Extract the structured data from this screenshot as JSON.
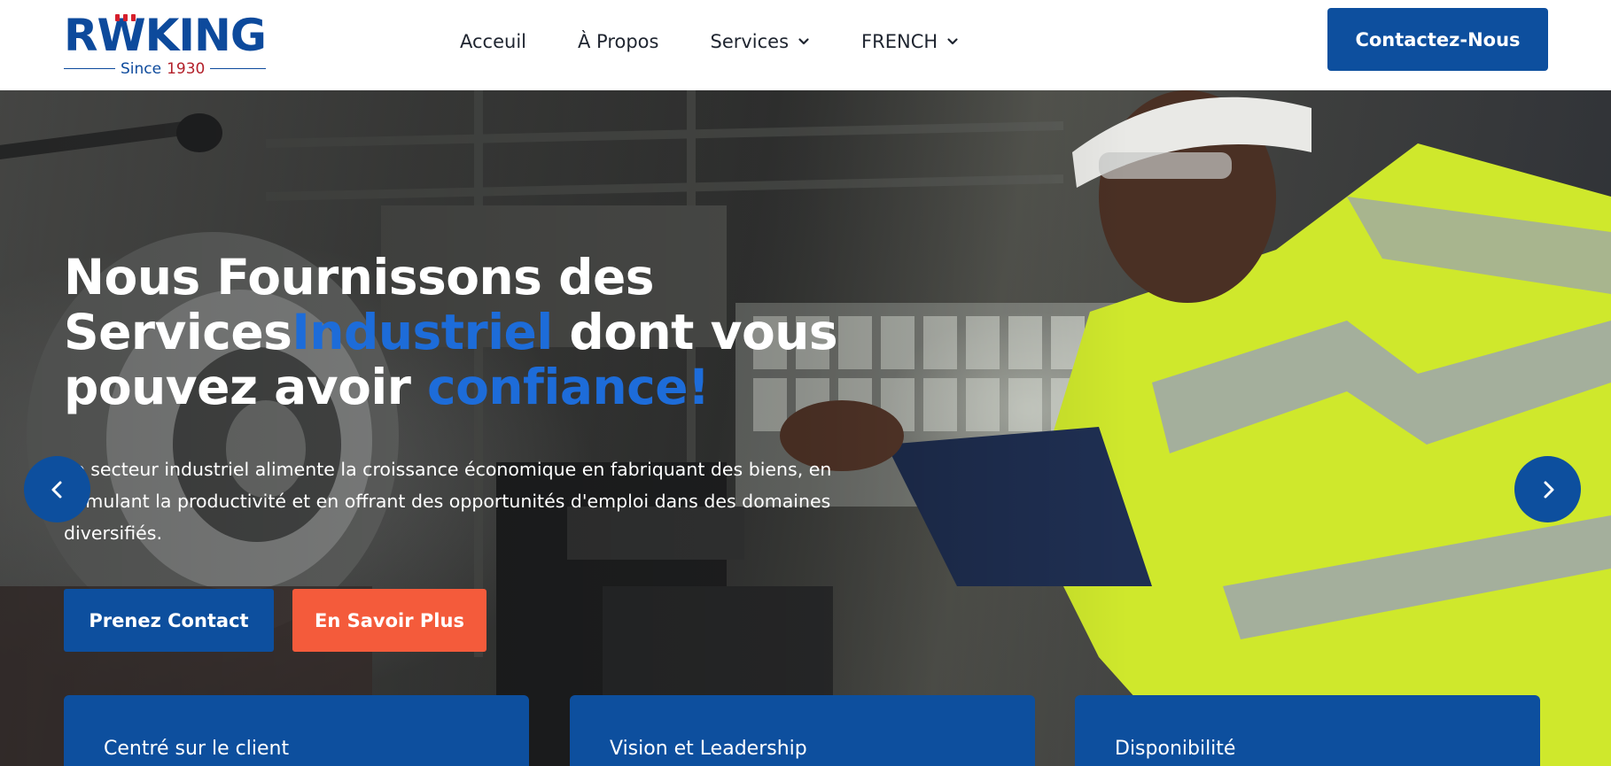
{
  "brand": {
    "logo_word": "RWKING",
    "since_word": "Since",
    "since_year": "1930",
    "primary_color": "#0d4f9e",
    "accent_red": "#d61f2c"
  },
  "nav": {
    "items": [
      {
        "label": "Acceuil",
        "has_dropdown": false
      },
      {
        "label": "À Propos",
        "has_dropdown": false
      },
      {
        "label": "Services",
        "has_dropdown": true
      },
      {
        "label": "FRENCH",
        "has_dropdown": true
      }
    ],
    "contact_label": "Contactez-Nous"
  },
  "hero": {
    "title_line1": "Nous Fournissons des",
    "title_line2_a": "Services",
    "title_line2_accent": "Industriel",
    "title_line2_b": " dont vous",
    "title_line3_a": "pouvez avoir ",
    "title_line3_accent": "confiance!",
    "description": "Le secteur industriel alimente la croissance économique en fabriquant des biens, en stimulant la productivité et en offrant des opportunités d'emploi dans des domaines diversifiés.",
    "primary_button": "Prenez Contact",
    "secondary_button": "En Savoir Plus",
    "accent_color": "#1d6cd9",
    "secondary_color": "#f45b3b",
    "prev_icon": "chevron-left-icon",
    "next_icon": "chevron-right-icon"
  },
  "features": [
    {
      "title": "Centré sur le client"
    },
    {
      "title": "Vision et Leadership"
    },
    {
      "title": "Disponibilité"
    }
  ]
}
